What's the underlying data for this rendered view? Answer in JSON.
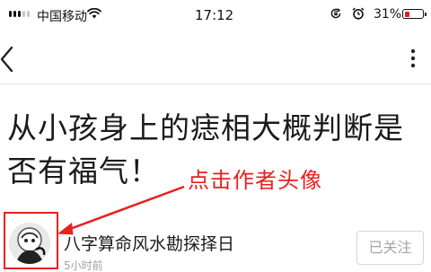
{
  "status_bar": {
    "carrier": "中国移动",
    "time": "17:12",
    "battery_percent": "31%",
    "battery_level": 0.31,
    "signal_bars_active": 3,
    "icons": [
      "signal-icon",
      "wifi-icon",
      "rotation-lock-icon",
      "alarm-icon",
      "battery-icon"
    ]
  },
  "nav": {
    "back_icon": "chevron-left-icon",
    "more_icon": "more-dots-icon"
  },
  "article": {
    "title": "从小孩身上的痣相大概判断是否有福气！"
  },
  "annotation": {
    "text": "点击作者头像",
    "color": "#e8201e"
  },
  "author": {
    "name": "八字算命风水勘探择日",
    "time": "5小时前",
    "follow_label": "已关注"
  }
}
